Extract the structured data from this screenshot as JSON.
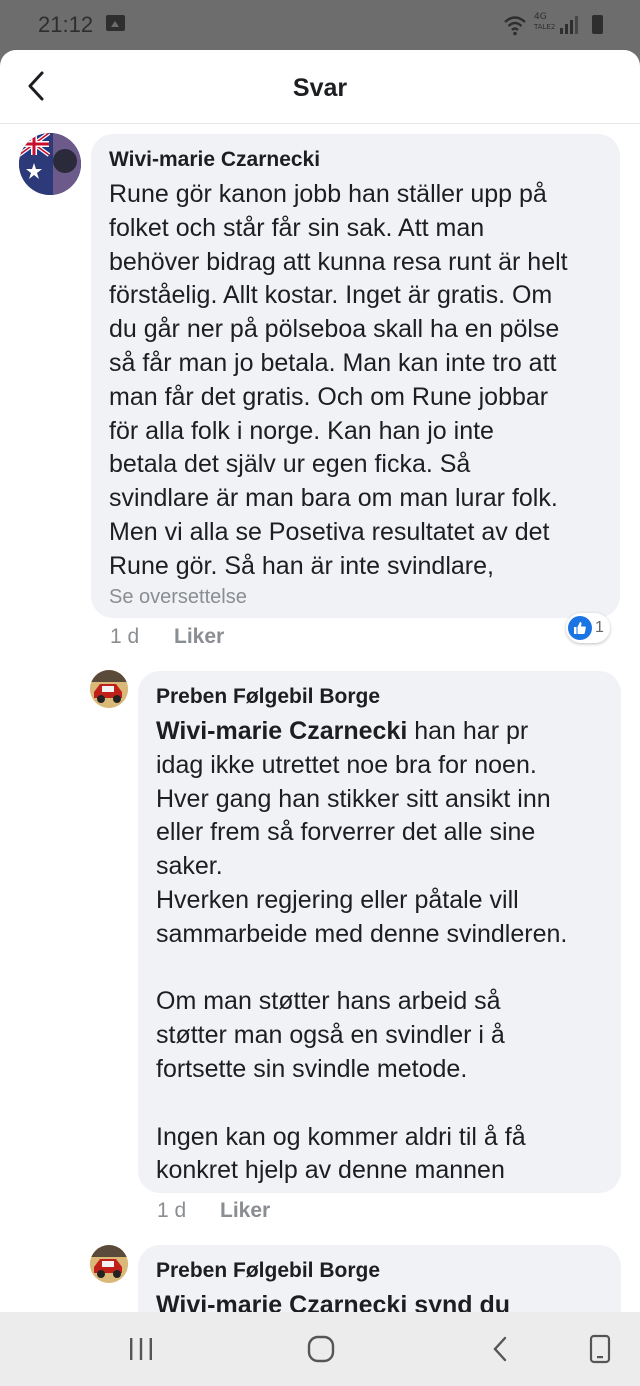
{
  "status_bar": {
    "time": "21:12",
    "network_label": "4G",
    "network_sub": "TALE2"
  },
  "header": {
    "title": "Svar"
  },
  "comments": [
    {
      "author": "Wivi-marie Czarnecki",
      "text": "Rune gör kanon jobb han ställer upp på\nfolket och står får sin sak. Att man\nbehöver bidrag att kunna resa runt är helt\nförståelig. Allt kostar. Inget är gratis. Om\ndu går ner på pölseboa  skall ha en pölse\nså får man jo betala. Man kan inte tro att\nman får det gratis. Och om Rune jobbar\nför alla folk i norge. Kan han jo inte\nbetala det själv ur egen ficka. Så\nsvindlare är man bara om man lurar folk.\nMen vi alla se Posetiva resultatet av det\nRune gör. Så han är inte svindlare,",
      "see_translation": "Se oversettelse",
      "time": "1 d",
      "like_label": "Liker",
      "reaction_count": "1"
    },
    {
      "author": "Preben Følgebil Borge",
      "mention": "Wivi-marie Czarnecki",
      "text_first_line": " han har pr",
      "text": "idag ikke utrettet noe bra for noen.\nHver gang han stikker sitt ansikt inn\neller frem så forverrer det alle sine\nsaker.\nHverken regjering eller påtale vill\nsammarbeide med denne svindleren.\n\nOm man støtter hans arbeid så\nstøtter man også en svindler i å\nfortsette sin svindle metode.\n\nIngen kan og kommer aldri til å få\nkonkret hjelp av denne mannen",
      "time": "1 d",
      "like_label": "Liker"
    },
    {
      "author": "Preben Følgebil Borge",
      "partial_text": "Wivi-marie Czarnecki synd du"
    }
  ],
  "colors": {
    "bubble": "#f0f2f5",
    "meta_text": "#8a8d91",
    "like_blue": "#1b74e4"
  }
}
